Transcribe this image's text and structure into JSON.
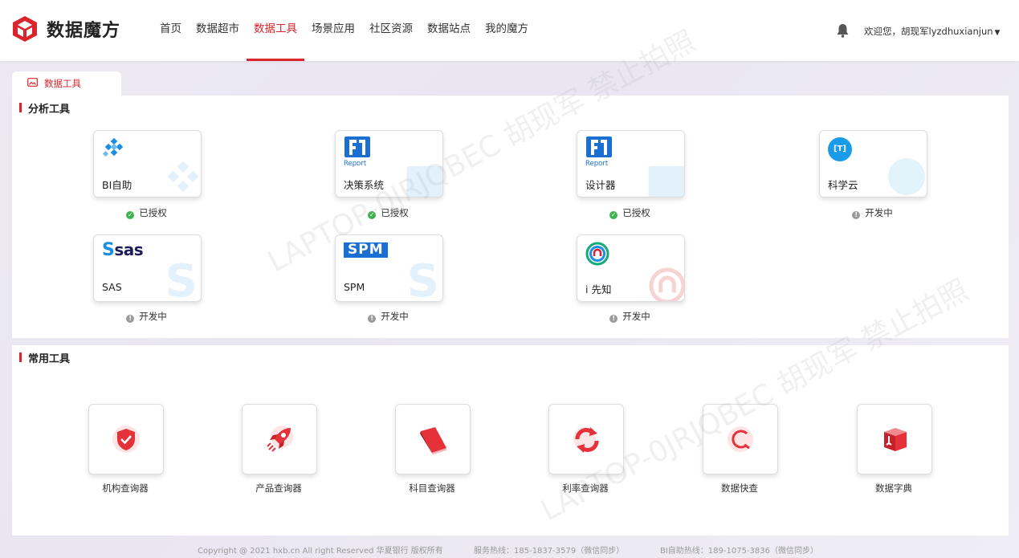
{
  "app": {
    "name": "数据魔方"
  },
  "nav": {
    "items": [
      {
        "label": "首页"
      },
      {
        "label": "数据超市"
      },
      {
        "label": "数据工具",
        "active": true
      },
      {
        "label": "场景应用"
      },
      {
        "label": "社区资源"
      },
      {
        "label": "数据站点"
      },
      {
        "label": "我的魔方"
      }
    ]
  },
  "header": {
    "welcome": "欢迎您，胡现军lyzdhuxianjun",
    "dropdown": "▼"
  },
  "tab": {
    "label": "数据工具"
  },
  "analysis": {
    "title": "分析工具",
    "cards": [
      {
        "name": "BI自助",
        "icon": "bi-diamond-icon",
        "status": "已授权",
        "state": "authorized"
      },
      {
        "name": "决策系统",
        "icon": "report-icon",
        "icon_text": "Report",
        "status": "已授权",
        "state": "authorized"
      },
      {
        "name": "设计器",
        "icon": "report-icon",
        "icon_text": "Report",
        "status": "已授权",
        "state": "authorized"
      },
      {
        "name": "科学云",
        "icon": "science-cloud-icon",
        "icon_text": "[T]",
        "status": "开发中",
        "state": "developing"
      },
      {
        "name": "SAS",
        "icon": "sas-logo-icon",
        "icon_text": "sas",
        "status": "开发中",
        "state": "developing"
      },
      {
        "name": "SPM",
        "icon": "spm-logo-icon",
        "icon_text": "SPM",
        "status": "开发中",
        "state": "developing"
      },
      {
        "name": "i 先知",
        "icon": "ixianzhi-icon",
        "status": "开发中",
        "state": "developing"
      }
    ]
  },
  "common": {
    "title": "常用工具",
    "tools": [
      {
        "label": "机构查询器",
        "icon": "shield-check-icon"
      },
      {
        "label": "产品查询器",
        "icon": "rocket-icon"
      },
      {
        "label": "科目查询器",
        "icon": "book-icon"
      },
      {
        "label": "利率查询器",
        "icon": "refresh-arrows-icon"
      },
      {
        "label": "数据快查",
        "icon": "search-loop-icon"
      },
      {
        "label": "数据字典",
        "icon": "dictionary-box-icon"
      }
    ]
  },
  "footer": {
    "copyright": "Copyright @ 2021 hxb.cn All right Reserved 华夏银行 版权所有",
    "hotline": "服务热线：185-1837-3579（微信同步）",
    "bi_hotline": "BI自助热线：189-1075-3836（微信同步）"
  },
  "watermark": {
    "line1": "LAPTOP-0JRJQBEC 胡现军 禁止拍照"
  },
  "colors": {
    "accent": "#d9252b",
    "ok": "#3fb34f",
    "dev": "#9a9a9a",
    "blue": "#1a8fe3"
  }
}
